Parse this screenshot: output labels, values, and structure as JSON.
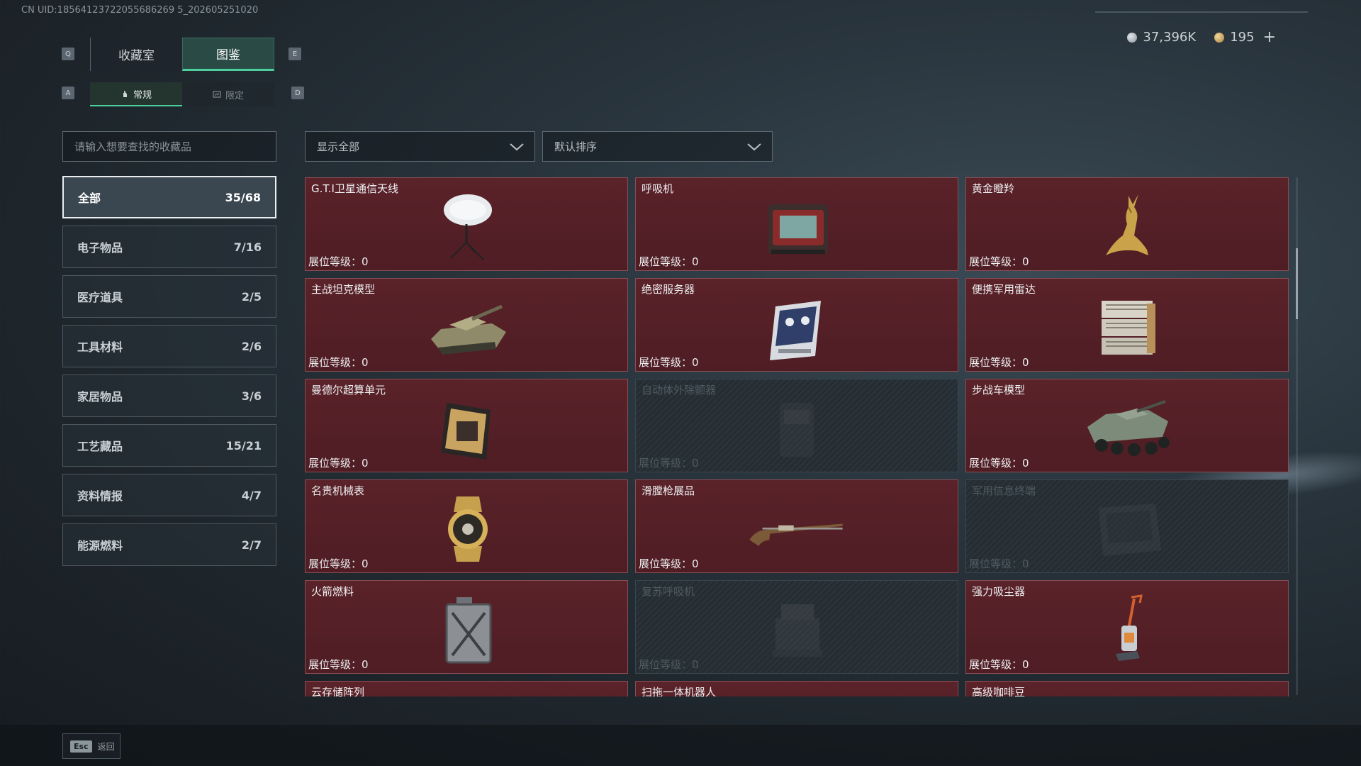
{
  "uid_text": "CN UID:18564123722055686269 5_202605251020",
  "currency": {
    "silver": "37,396K",
    "gold": "195",
    "add": "+"
  },
  "keys": {
    "q": "Q",
    "e": "E",
    "a": "A",
    "d": "D"
  },
  "tabs": {
    "main": [
      "收藏室",
      "图鉴"
    ],
    "sub": [
      "常规",
      "限定"
    ]
  },
  "search": {
    "placeholder": "请输入想要查找的收藏品"
  },
  "filters": {
    "show": "显示全部",
    "sort": "默认排序"
  },
  "categories": [
    {
      "label": "全部",
      "count": "35/68"
    },
    {
      "label": "电子物品",
      "count": "7/16"
    },
    {
      "label": "医疗道具",
      "count": "2/5"
    },
    {
      "label": "工具材料",
      "count": "2/6"
    },
    {
      "label": "家居物品",
      "count": "3/6"
    },
    {
      "label": "工艺藏品",
      "count": "15/21"
    },
    {
      "label": "资料情报",
      "count": "4/7"
    },
    {
      "label": "能源燃料",
      "count": "2/7"
    }
  ],
  "items": [
    {
      "name": "G.T.I卫星通信天线",
      "level": "展位等级：0",
      "icon": "satellite-dish-icon",
      "locked": false
    },
    {
      "name": "呼吸机",
      "level": "展位等级：0",
      "icon": "ventilator-icon",
      "locked": false
    },
    {
      "name": "黄金瞪羚",
      "level": "展位等级：0",
      "icon": "gold-gazelle-icon",
      "locked": false
    },
    {
      "name": "主战坦克模型",
      "level": "展位等级：0",
      "icon": "tank-icon",
      "locked": false
    },
    {
      "name": "绝密服务器",
      "level": "展位等级：0",
      "icon": "server-icon",
      "locked": false
    },
    {
      "name": "便携军用雷达",
      "level": "展位等级：0",
      "icon": "radar-icon",
      "locked": false
    },
    {
      "name": "曼德尔超算单元",
      "level": "展位等级：0",
      "icon": "supercomputer-icon",
      "locked": false
    },
    {
      "name": "自动体外除颤器",
      "level": "展位等级：0",
      "icon": "defibrillator-icon",
      "locked": true
    },
    {
      "name": "步战车模型",
      "level": "展位等级：0",
      "icon": "ifv-icon",
      "locked": false
    },
    {
      "name": "名贵机械表",
      "level": "展位等级：0",
      "icon": "watch-icon",
      "locked": false
    },
    {
      "name": "滑膛枪展品",
      "level": "展位等级：0",
      "icon": "musket-icon",
      "locked": false
    },
    {
      "name": "军用信息终端",
      "level": "展位等级：0",
      "icon": "terminal-icon",
      "locked": true
    },
    {
      "name": "火箭燃料",
      "level": "展位等级：0",
      "icon": "fuel-can-icon",
      "locked": false
    },
    {
      "name": "复苏呼吸机",
      "level": "展位等级：0",
      "icon": "resuscitator-icon",
      "locked": true
    },
    {
      "name": "强力吸尘器",
      "level": "展位等级：0",
      "icon": "vacuum-icon",
      "locked": false
    },
    {
      "name": "云存储阵列",
      "level": "",
      "icon": "storage-array-icon",
      "locked": false
    },
    {
      "name": "扫拖一体机器人",
      "level": "",
      "icon": "robot-vacuum-icon",
      "locked": false
    },
    {
      "name": "高级咖啡豆",
      "level": "",
      "icon": "coffee-icon",
      "locked": false
    }
  ],
  "footer": {
    "esc_key": "Esc",
    "back_label": "返回"
  }
}
